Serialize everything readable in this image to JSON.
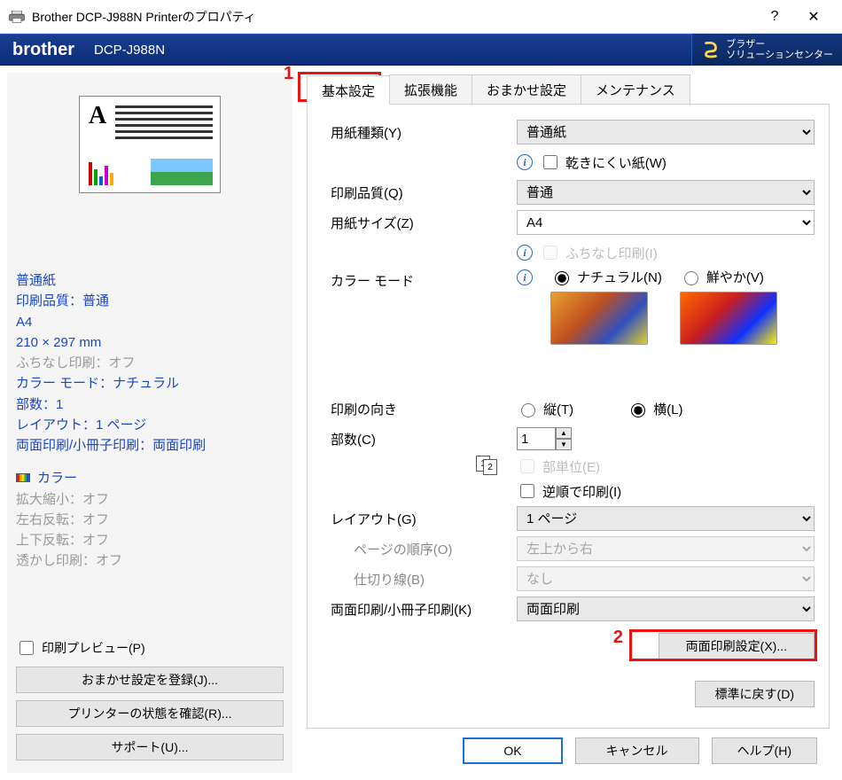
{
  "window": {
    "title": "Brother DCP-J988N Printerのプロパティ",
    "help": "?",
    "close": "✕"
  },
  "brandbar": {
    "brand": "brother",
    "model": "DCP-J988N",
    "solution_line1": "ブラザー",
    "solution_line2": "ソリューションセンター"
  },
  "summary": {
    "media": "普通紙",
    "quality": "印刷品質：普通",
    "size_name": "A4",
    "size_dim": "210 × 297 mm",
    "borderless": "ふちなし印刷：オフ",
    "colormode": "カラー モード：ナチュラル",
    "copies": "部数：1",
    "layout": "レイアウト：1 ページ",
    "duplex": "両面印刷/小冊子印刷：両面印刷",
    "color": "カラー",
    "scaling": "拡大縮小：オフ",
    "mirror_h": "左右反転：オフ",
    "mirror_v": "上下反転：オフ",
    "watermark": "透かし印刷：オフ"
  },
  "left_buttons": {
    "preview_chk": "印刷プレビュー(P)",
    "register": "おまかせ設定を登録(J)...",
    "status": "プリンターの状態を確認(R)...",
    "support": "サポート(U)..."
  },
  "tabs": {
    "basic": "基本設定",
    "advanced": "拡張機能",
    "easy": "おまかせ設定",
    "maintenance": "メンテナンス"
  },
  "form": {
    "media_type_label": "用紙種類(Y)",
    "media_type_value": "普通紙",
    "slow_dry_label": "乾きにくい紙(W)",
    "quality_label": "印刷品質(Q)",
    "quality_value": "普通",
    "size_label": "用紙サイズ(Z)",
    "size_value": "A4",
    "borderless_label": "ふちなし印刷(I)",
    "colormode_label": "カラー モード",
    "colormode_natural": "ナチュラル(N)",
    "colormode_vivid": "鮮やか(V)",
    "orient_label": "印刷の向き",
    "orient_portrait": "縦(T)",
    "orient_landscape": "横(L)",
    "copies_label": "部数(C)",
    "copies_value": "1",
    "collate_label": "部単位(E)",
    "reverse_label": "逆順で印刷(I)",
    "layout_label": "レイアウト(G)",
    "layout_value": "1 ページ",
    "page_order_label": "ページの順序(O)",
    "page_order_value": "左上から右",
    "border_label": "仕切り線(B)",
    "border_value": "なし",
    "duplex_label": "両面印刷/小冊子印刷(K)",
    "duplex_value": "両面印刷",
    "duplex_settings_btn": "両面印刷設定(X)...",
    "restore_btn": "標準に戻す(D)"
  },
  "bottom": {
    "ok": "OK",
    "cancel": "キャンセル",
    "help": "ヘルプ(H)"
  },
  "annotations": {
    "n1": "1",
    "n2": "2"
  }
}
